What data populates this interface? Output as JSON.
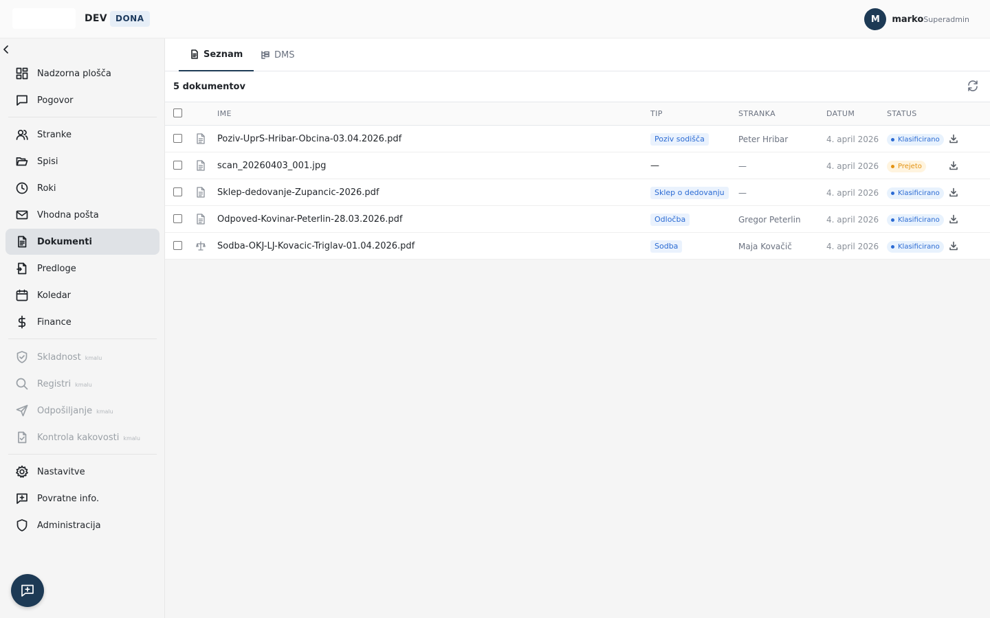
{
  "header": {
    "env": "DEV",
    "brand": "DONA",
    "user": {
      "initial": "M",
      "name": "marko",
      "role": "Superadmin"
    }
  },
  "sidebar": {
    "items": [
      {
        "label": "Nadzorna plošča",
        "icon": "dashboard-icon"
      },
      {
        "label": "Pogovor",
        "icon": "chat-icon"
      },
      {
        "label": "Stranke",
        "icon": "users-icon"
      },
      {
        "label": "Spisi",
        "icon": "folder-icon"
      },
      {
        "label": "Roki",
        "icon": "clock-icon"
      },
      {
        "label": "Vhodna pošta",
        "icon": "mail-icon"
      },
      {
        "label": "Dokumenti",
        "icon": "document-icon",
        "active": true
      },
      {
        "label": "Predloge",
        "icon": "template-icon"
      },
      {
        "label": "Koledar",
        "icon": "calendar-icon"
      },
      {
        "label": "Finance",
        "icon": "dollar-icon"
      },
      {
        "label": "Skladnost",
        "icon": "shield-check-icon",
        "disabled": true,
        "badge": "kmalu"
      },
      {
        "label": "Registri",
        "icon": "search-icon",
        "disabled": true,
        "badge": "kmalu"
      },
      {
        "label": "Odpošiljanje",
        "icon": "send-icon",
        "disabled": true,
        "badge": "kmalu"
      },
      {
        "label": "Kontrola kakovosti",
        "icon": "file-check-icon",
        "disabled": true,
        "badge": "kmalu"
      },
      {
        "label": "Nastavitve",
        "icon": "gear-icon"
      },
      {
        "label": "Povratne info.",
        "icon": "feedback-icon"
      },
      {
        "label": "Administracija",
        "icon": "shield-icon"
      }
    ]
  },
  "tabs": [
    {
      "label": "Seznam",
      "icon": "document-icon",
      "active": true
    },
    {
      "label": "DMS",
      "icon": "hierarchy-icon"
    }
  ],
  "documents": {
    "count_label": "5 dokumentov",
    "columns": [
      "IME",
      "TIP",
      "STRANKA",
      "DATUM",
      "STATUS"
    ],
    "rows": [
      {
        "name": "Poziv-UprS-Hribar-Obcina-03.04.2026.pdf",
        "type": "Poziv sodišča",
        "client": "Peter Hribar",
        "date": "4. april 2026",
        "status": "Klasificirano",
        "icon": "document-icon"
      },
      {
        "name": "scan_20260403_001.jpg",
        "type": "—",
        "client": "—",
        "date": "4. april 2026",
        "status": "Prejeto",
        "icon": "document-icon"
      },
      {
        "name": "Sklep-dedovanje-Zupancic-2026.pdf",
        "type": "Sklep o dedovanju",
        "client": "—",
        "date": "4. april 2026",
        "status": "Klasificirano",
        "icon": "document-icon"
      },
      {
        "name": "Odpoved-Kovinar-Peterlin-28.03.2026.pdf",
        "type": "Odločba",
        "client": "Gregor Peterlin",
        "date": "4. april 2026",
        "status": "Klasificirano",
        "icon": "document-icon"
      },
      {
        "name": "Sodba-OKJ-LJ-Kovacic-Triglav-01.04.2026.pdf",
        "type": "Sodba",
        "client": "Maja Kovačič",
        "date": "4. april 2026",
        "status": "Klasificirano",
        "icon": "scale-icon"
      }
    ]
  },
  "colors": {
    "primary": "#1d3a55",
    "tag_blue": "#2a6ad3",
    "status_orange": "#e39211"
  }
}
